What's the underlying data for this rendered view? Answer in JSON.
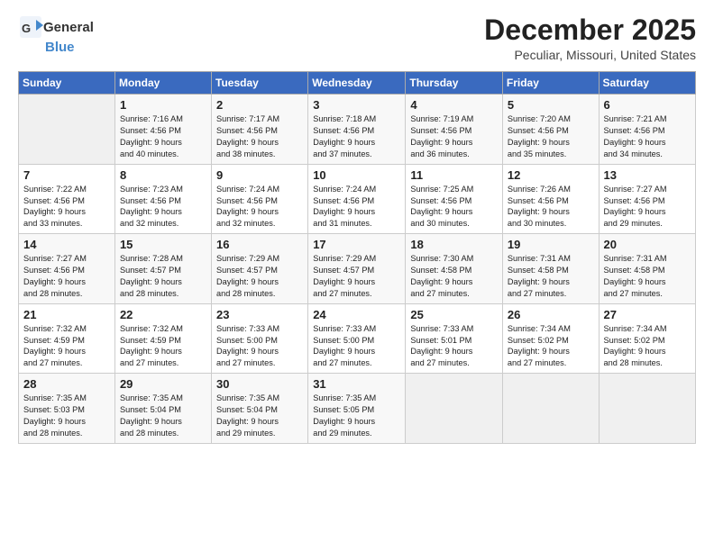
{
  "header": {
    "logo_general": "General",
    "logo_blue": "Blue",
    "month_title": "December 2025",
    "location": "Peculiar, Missouri, United States"
  },
  "days_of_week": [
    "Sunday",
    "Monday",
    "Tuesday",
    "Wednesday",
    "Thursday",
    "Friday",
    "Saturday"
  ],
  "weeks": [
    [
      {
        "day": "",
        "info": ""
      },
      {
        "day": "1",
        "info": "Sunrise: 7:16 AM\nSunset: 4:56 PM\nDaylight: 9 hours\nand 40 minutes."
      },
      {
        "day": "2",
        "info": "Sunrise: 7:17 AM\nSunset: 4:56 PM\nDaylight: 9 hours\nand 38 minutes."
      },
      {
        "day": "3",
        "info": "Sunrise: 7:18 AM\nSunset: 4:56 PM\nDaylight: 9 hours\nand 37 minutes."
      },
      {
        "day": "4",
        "info": "Sunrise: 7:19 AM\nSunset: 4:56 PM\nDaylight: 9 hours\nand 36 minutes."
      },
      {
        "day": "5",
        "info": "Sunrise: 7:20 AM\nSunset: 4:56 PM\nDaylight: 9 hours\nand 35 minutes."
      },
      {
        "day": "6",
        "info": "Sunrise: 7:21 AM\nSunset: 4:56 PM\nDaylight: 9 hours\nand 34 minutes."
      }
    ],
    [
      {
        "day": "7",
        "info": "Sunrise: 7:22 AM\nSunset: 4:56 PM\nDaylight: 9 hours\nand 33 minutes."
      },
      {
        "day": "8",
        "info": "Sunrise: 7:23 AM\nSunset: 4:56 PM\nDaylight: 9 hours\nand 32 minutes."
      },
      {
        "day": "9",
        "info": "Sunrise: 7:24 AM\nSunset: 4:56 PM\nDaylight: 9 hours\nand 32 minutes."
      },
      {
        "day": "10",
        "info": "Sunrise: 7:24 AM\nSunset: 4:56 PM\nDaylight: 9 hours\nand 31 minutes."
      },
      {
        "day": "11",
        "info": "Sunrise: 7:25 AM\nSunset: 4:56 PM\nDaylight: 9 hours\nand 30 minutes."
      },
      {
        "day": "12",
        "info": "Sunrise: 7:26 AM\nSunset: 4:56 PM\nDaylight: 9 hours\nand 30 minutes."
      },
      {
        "day": "13",
        "info": "Sunrise: 7:27 AM\nSunset: 4:56 PM\nDaylight: 9 hours\nand 29 minutes."
      }
    ],
    [
      {
        "day": "14",
        "info": "Sunrise: 7:27 AM\nSunset: 4:56 PM\nDaylight: 9 hours\nand 28 minutes."
      },
      {
        "day": "15",
        "info": "Sunrise: 7:28 AM\nSunset: 4:57 PM\nDaylight: 9 hours\nand 28 minutes."
      },
      {
        "day": "16",
        "info": "Sunrise: 7:29 AM\nSunset: 4:57 PM\nDaylight: 9 hours\nand 28 minutes."
      },
      {
        "day": "17",
        "info": "Sunrise: 7:29 AM\nSunset: 4:57 PM\nDaylight: 9 hours\nand 27 minutes."
      },
      {
        "day": "18",
        "info": "Sunrise: 7:30 AM\nSunset: 4:58 PM\nDaylight: 9 hours\nand 27 minutes."
      },
      {
        "day": "19",
        "info": "Sunrise: 7:31 AM\nSunset: 4:58 PM\nDaylight: 9 hours\nand 27 minutes."
      },
      {
        "day": "20",
        "info": "Sunrise: 7:31 AM\nSunset: 4:58 PM\nDaylight: 9 hours\nand 27 minutes."
      }
    ],
    [
      {
        "day": "21",
        "info": "Sunrise: 7:32 AM\nSunset: 4:59 PM\nDaylight: 9 hours\nand 27 minutes."
      },
      {
        "day": "22",
        "info": "Sunrise: 7:32 AM\nSunset: 4:59 PM\nDaylight: 9 hours\nand 27 minutes."
      },
      {
        "day": "23",
        "info": "Sunrise: 7:33 AM\nSunset: 5:00 PM\nDaylight: 9 hours\nand 27 minutes."
      },
      {
        "day": "24",
        "info": "Sunrise: 7:33 AM\nSunset: 5:00 PM\nDaylight: 9 hours\nand 27 minutes."
      },
      {
        "day": "25",
        "info": "Sunrise: 7:33 AM\nSunset: 5:01 PM\nDaylight: 9 hours\nand 27 minutes."
      },
      {
        "day": "26",
        "info": "Sunrise: 7:34 AM\nSunset: 5:02 PM\nDaylight: 9 hours\nand 27 minutes."
      },
      {
        "day": "27",
        "info": "Sunrise: 7:34 AM\nSunset: 5:02 PM\nDaylight: 9 hours\nand 28 minutes."
      }
    ],
    [
      {
        "day": "28",
        "info": "Sunrise: 7:35 AM\nSunset: 5:03 PM\nDaylight: 9 hours\nand 28 minutes."
      },
      {
        "day": "29",
        "info": "Sunrise: 7:35 AM\nSunset: 5:04 PM\nDaylight: 9 hours\nand 28 minutes."
      },
      {
        "day": "30",
        "info": "Sunrise: 7:35 AM\nSunset: 5:04 PM\nDaylight: 9 hours\nand 29 minutes."
      },
      {
        "day": "31",
        "info": "Sunrise: 7:35 AM\nSunset: 5:05 PM\nDaylight: 9 hours\nand 29 minutes."
      },
      {
        "day": "",
        "info": ""
      },
      {
        "day": "",
        "info": ""
      },
      {
        "day": "",
        "info": ""
      }
    ]
  ]
}
